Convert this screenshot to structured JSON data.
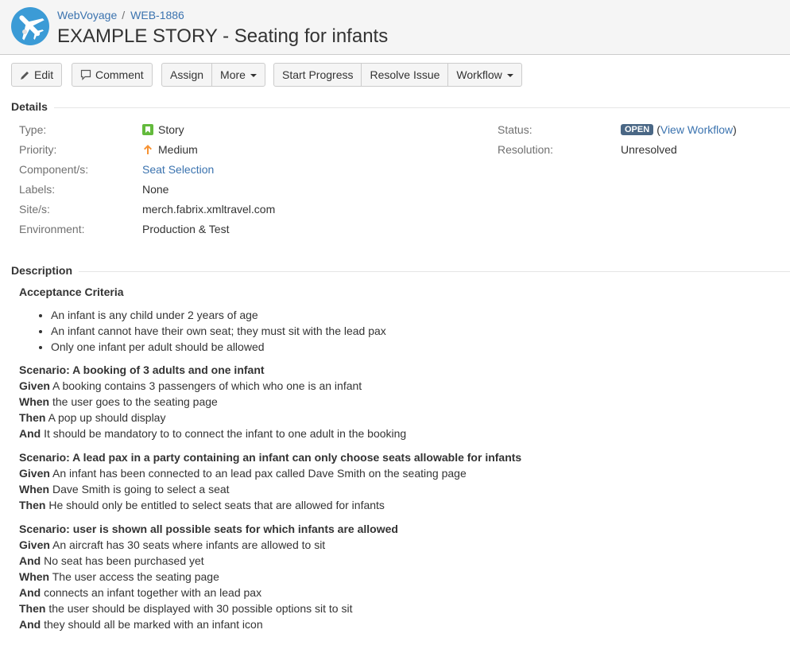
{
  "header": {
    "breadcrumb": {
      "project": "WebVoyage",
      "separator": "/",
      "issue_key": "WEB-1886"
    },
    "title": "EXAMPLE STORY - Seating for infants"
  },
  "toolbar": {
    "edit": "Edit",
    "comment": "Comment",
    "assign": "Assign",
    "more": "More",
    "start_progress": "Start Progress",
    "resolve_issue": "Resolve Issue",
    "workflow": "Workflow"
  },
  "details": {
    "heading": "Details",
    "type_label": "Type:",
    "type_value": "Story",
    "priority_label": "Priority:",
    "priority_value": "Medium",
    "components_label": "Component/s:",
    "components_value": "Seat Selection",
    "labels_label": "Labels:",
    "labels_value": "None",
    "sites_label": "Site/s:",
    "sites_value": "merch.fabrix.xmltravel.com",
    "environment_label": "Environment:",
    "environment_value": "Production & Test",
    "status_label": "Status:",
    "status_value": "OPEN",
    "view_workflow_open": "(",
    "view_workflow": "View Workflow",
    "view_workflow_close": ")",
    "resolution_label": "Resolution:",
    "resolution_value": "Unresolved"
  },
  "description": {
    "heading": "Description",
    "acceptance_title": "Acceptance Criteria",
    "criteria": [
      "An infant is any child under 2 years of age",
      "An infant cannot have their own seat; they must sit with the lead pax",
      "Only one infant per adult should be allowed"
    ],
    "scenarios": [
      {
        "title": "Scenario: A booking of 3 adults and one infant",
        "steps": [
          {
            "kw": "Given",
            "text": " A booking contains 3 passengers of which who one is an infant"
          },
          {
            "kw": "When",
            "text": " the user goes to the seating page"
          },
          {
            "kw": "Then",
            "text": " A pop up should display"
          },
          {
            "kw": "And",
            "text": " It should be mandatory to to connect the infant to one adult in the booking"
          }
        ]
      },
      {
        "title": "Scenario: A lead pax in a party containing an infant can only choose seats allowable for infants",
        "steps": [
          {
            "kw": "Given",
            "text": " An infant has been connected to an lead pax called Dave Smith on the seating page"
          },
          {
            "kw": "When",
            "text": " Dave Smith is going to select a seat"
          },
          {
            "kw": "Then",
            "text": " He should only be entitled to select seats that are allowed for infants"
          }
        ]
      },
      {
        "title": "Scenario: user is shown all possible seats for which infants are allowed",
        "steps": [
          {
            "kw": "Given",
            "text": " An aircraft has 30 seats where infants are allowed to sit"
          },
          {
            "kw": "And",
            "text": " No seat has been purchased yet"
          },
          {
            "kw": "When",
            "text": " The user access the seating page"
          },
          {
            "kw": "And",
            "text": " connects an infant together with an lead pax"
          },
          {
            "kw": "Then",
            "text": " the user should be displayed with 30 possible options sit to sit"
          },
          {
            "kw": "And",
            "text": " they should all be marked with an infant icon"
          }
        ]
      }
    ]
  },
  "icons": {
    "project_logo": "airplane-logo",
    "edit": "pencil-icon",
    "comment": "speech-bubble-icon",
    "story": "story-icon",
    "priority": "arrow-up-icon"
  },
  "colors": {
    "link": "#3b73af",
    "status_badge": "#4a6785",
    "story_icon": "#63ba3c",
    "priority_medium": "#f79232",
    "logo_bg": "#3b9bd6"
  }
}
